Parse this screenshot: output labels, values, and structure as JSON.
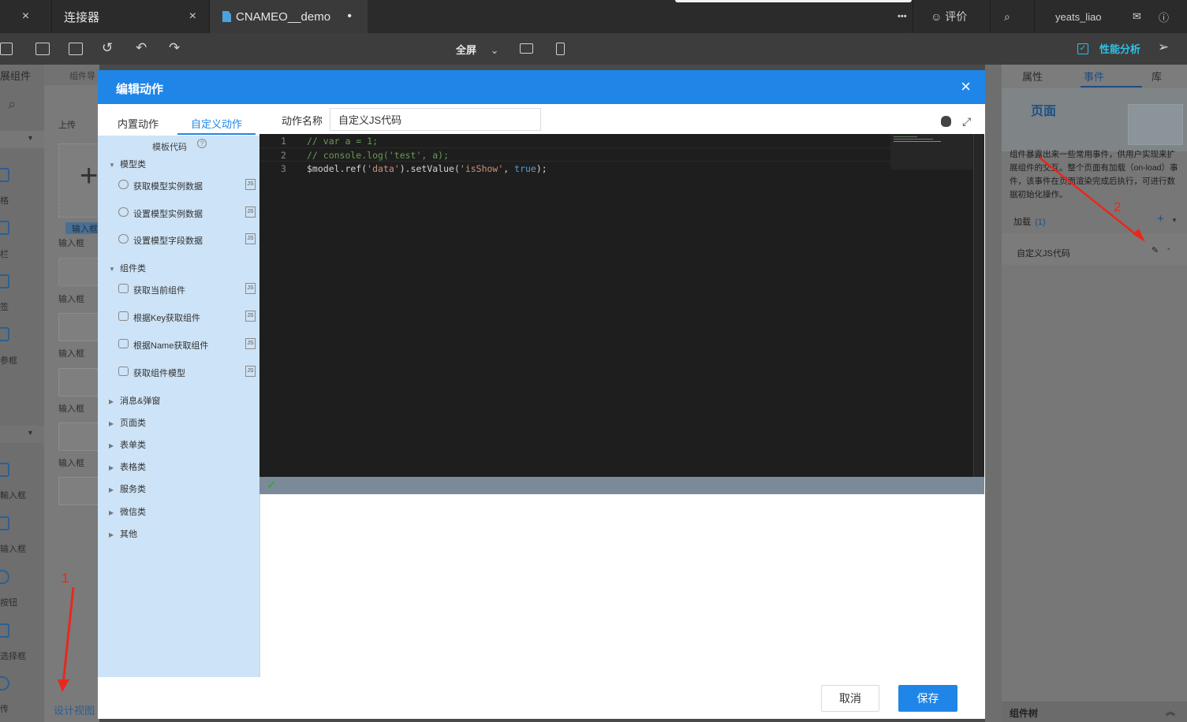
{
  "tabs": [
    {
      "label": "",
      "close": "×"
    },
    {
      "label": "连接器",
      "close": "×"
    },
    {
      "label": "CNAMEO__demo",
      "dot": "•"
    }
  ],
  "topbar": {
    "more": "•••",
    "rate": "评价",
    "user": "yeats_liao"
  },
  "toolbar": {
    "fullscreen": "全屏",
    "performance": "性能分析"
  },
  "left": {
    "header": "展组件",
    "nav_label": "组件导",
    "upload": "上传",
    "input_tag": "输入框",
    "strip_labels": [
      "格",
      "栏",
      "签",
      "参框",
      "輸入框",
      "输入框",
      "按钮",
      "选择框",
      "传"
    ],
    "ghost_labels": [
      "输入框",
      "输入框",
      "输入框",
      "输入框",
      "输入框"
    ],
    "design_view": "设计视图"
  },
  "modal": {
    "title": "编辑动作",
    "close": "×",
    "tabs": {
      "builtin": "内置动作",
      "custom": "自定义动作"
    },
    "template_label": "模板代码",
    "groups": [
      {
        "name": "模型类",
        "expanded": true,
        "items": [
          "获取模型实例数据",
          "设置模型实例数据",
          "设置模型字段数据"
        ]
      },
      {
        "name": "组件类",
        "expanded": true,
        "items": [
          "获取当前组件",
          "根据Key获取组件",
          "根据Name获取组件",
          "获取组件模型"
        ]
      },
      {
        "name": "消息&弹窗",
        "expanded": false,
        "items": []
      },
      {
        "name": "页面类",
        "expanded": false,
        "items": []
      },
      {
        "name": "表单类",
        "expanded": false,
        "items": []
      },
      {
        "name": "表格类",
        "expanded": false,
        "items": []
      },
      {
        "name": "服务类",
        "expanded": false,
        "items": []
      },
      {
        "name": "微信类",
        "expanded": false,
        "items": []
      },
      {
        "name": "其他",
        "expanded": false,
        "items": []
      }
    ],
    "action_name_label": "动作名称",
    "action_name_value": "自定义JS代码",
    "code_lines": [
      {
        "no": "1",
        "text": "// var a = 1;"
      },
      {
        "no": "2",
        "text": "// console.log('test', a);"
      },
      {
        "no": "3",
        "text": "$model.ref('data').setValue('isShow', true);"
      }
    ],
    "cancel": "取消",
    "save": "保存"
  },
  "right_panel": {
    "tabs": [
      "属性",
      "事件",
      "库"
    ],
    "active_tab": "事件",
    "title": "页面",
    "description": "组件暴露出来一些常用事件，供用户实现来扩展组件的交互。整个页面有加载（on-load）事件，该事件在页面渲染完成后执行，可进行数据初始化操作。",
    "event_group": "加载",
    "event_count": "(1)",
    "add": "+",
    "event_item": "自定义JS代码",
    "tree_label": "组件树"
  },
  "annotations": [
    "1",
    "2"
  ],
  "colors": {
    "primary": "#1f86e8",
    "editor_bg": "#1e1e1e",
    "annotation": "#e8281e"
  }
}
